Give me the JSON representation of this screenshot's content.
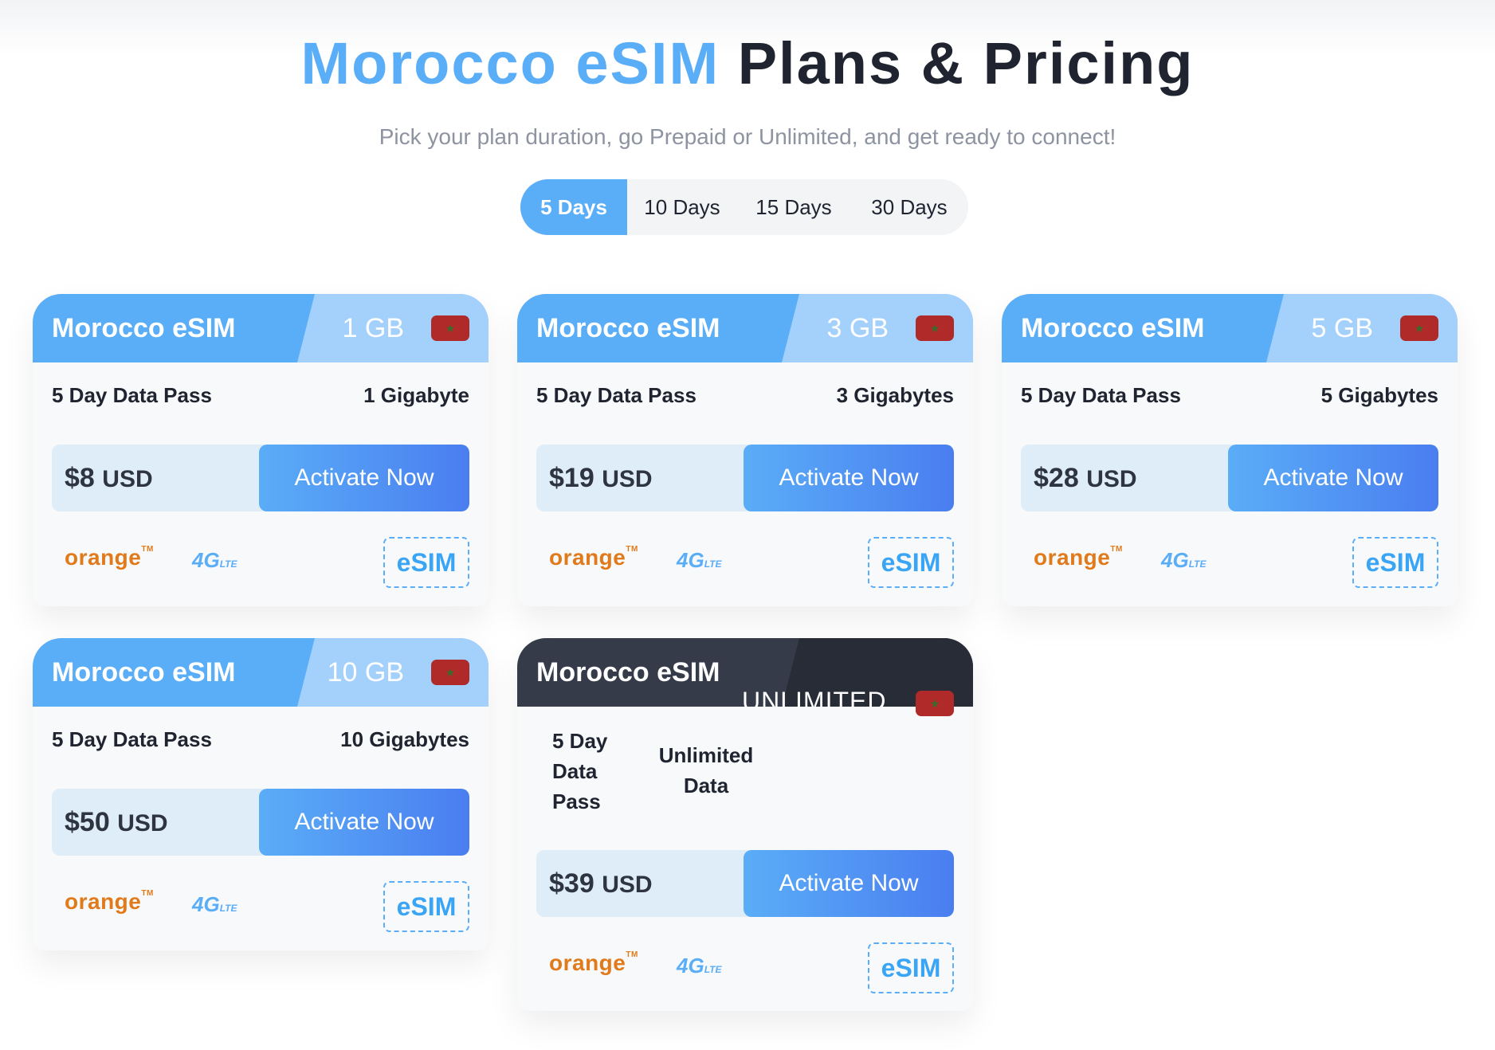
{
  "header": {
    "title_part1": "Morocco eSIM",
    "title_part2": "Plans & Pricing",
    "subtitle": "Pick your plan duration, go Prepaid or Unlimited, and get ready to connect!"
  },
  "tabs": [
    {
      "label": "5 Days",
      "active": true
    },
    {
      "label": "10 Days",
      "active": false
    },
    {
      "label": "15 Days",
      "active": false
    },
    {
      "label": "30 Days",
      "active": false
    }
  ],
  "plans": [
    {
      "name": "Morocco eSIM",
      "size": "1 GB",
      "pass": "5 Day Data Pass",
      "detail": "1 Gigabyte",
      "price": "$8",
      "currency": "USD",
      "cta": "Activate Now",
      "carrier": "orange",
      "network": "4G",
      "network_sub": "LTE",
      "badge": "eSIM"
    },
    {
      "name": "Morocco eSIM",
      "size": "3 GB",
      "pass": "5 Day Data Pass",
      "detail": "3 Gigabytes",
      "price": "$19",
      "currency": "USD",
      "cta": "Activate Now",
      "carrier": "orange",
      "network": "4G",
      "network_sub": "LTE",
      "badge": "eSIM"
    },
    {
      "name": "Morocco eSIM",
      "size": "5 GB",
      "pass": "5 Day Data Pass",
      "detail": "5 Gigabytes",
      "price": "$28",
      "currency": "USD",
      "cta": "Activate Now",
      "carrier": "orange",
      "network": "4G",
      "network_sub": "LTE",
      "badge": "eSIM"
    },
    {
      "name": "Morocco eSIM",
      "size": "10 GB",
      "pass": "5 Day Data Pass",
      "detail": "10 Gigabytes",
      "price": "$50",
      "currency": "USD",
      "cta": "Activate Now",
      "carrier": "orange",
      "network": "4G",
      "network_sub": "LTE",
      "badge": "eSIM"
    }
  ],
  "unlimited_plan": {
    "name": "Morocco eSIM",
    "tag": "UNLIMITED",
    "pass_line1": "5 Day",
    "pass_line2": "Data",
    "pass_line3": "Pass",
    "detail_line1": "Unlimited",
    "detail_line2": "Data",
    "price": "$39",
    "currency": "USD",
    "cta": "Activate Now",
    "carrier": "orange",
    "network": "4G",
    "network_sub": "LTE",
    "badge": "eSIM"
  },
  "icons": {
    "flag": "morocco-flag-icon"
  },
  "colors": {
    "accent": "#5aadf7",
    "accent_light": "#a3d1fb",
    "dark": "#1f2430",
    "carrier": "#e07a1a",
    "flag": "#b02a2a"
  }
}
